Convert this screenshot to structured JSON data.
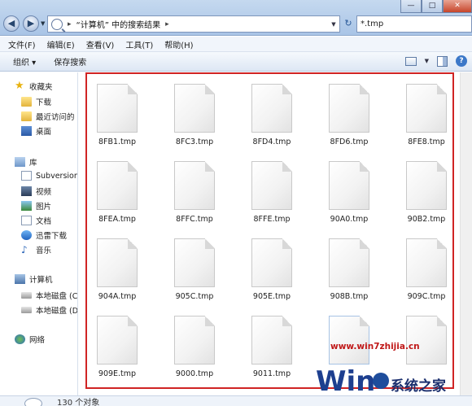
{
  "address": {
    "path": "“计算机” 中的搜索结果",
    "search_value": "*.tmp"
  },
  "menu": [
    "文件(F)",
    "编辑(E)",
    "查看(V)",
    "工具(T)",
    "帮助(H)"
  ],
  "toolbar": {
    "organize": "组织 ▾",
    "save_search": "保存搜索"
  },
  "nav": {
    "favorites": "收藏夹",
    "favorites_items": [
      "下载",
      "最近访问的",
      "桌面"
    ],
    "libraries": "库",
    "libraries_items": [
      "Subversion",
      "视频",
      "图片",
      "文档",
      "迅雷下载",
      "音乐"
    ],
    "computer": "计算机",
    "computer_items": [
      "本地磁盘 (C",
      "本地磁盘 (D"
    ],
    "network": "网络"
  },
  "files": [
    "8FB1.tmp",
    "8FC3.tmp",
    "8FD4.tmp",
    "8FD6.tmp",
    "8FE8.tmp",
    "8FEA.tmp",
    "8FFC.tmp",
    "8FFE.tmp",
    "90A0.tmp",
    "90B2.tmp",
    "904A.tmp",
    "905C.tmp",
    "905E.tmp",
    "908B.tmp",
    "909C.tmp",
    "909E.tmp",
    "9000.tmp",
    "9011.tmp"
  ],
  "status": {
    "count": "130 个对象"
  },
  "watermark": {
    "url": "www.win7zhijia.cn",
    "logo_text": "Win",
    "brand": "系统之家"
  }
}
